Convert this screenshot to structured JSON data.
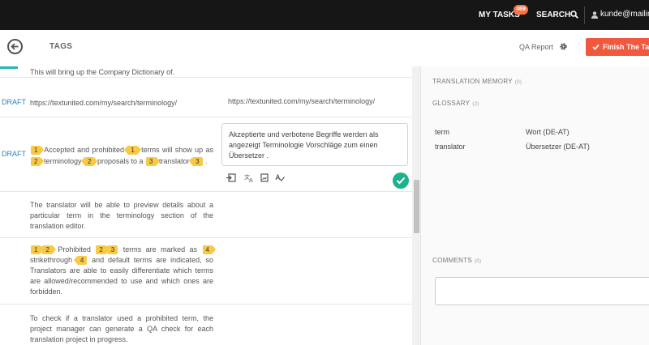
{
  "topnav": {
    "my_tasks": "MY TASKS",
    "task_count": "469",
    "search": "SEARCH",
    "user_email": "kunde@mailin"
  },
  "header": {
    "title": "TAGS",
    "qa_report": "QA Report",
    "finish": "Finish The Task"
  },
  "segments": [
    {
      "status": "",
      "source": "This will bring up the Company Dictionary of.",
      "target": ""
    },
    {
      "status": "DRAFT",
      "source": "https://textunited.com/my/search/terminology/",
      "target": "https://textunited.com/my/search/terminology/"
    },
    {
      "status": "DRAFT",
      "source_parts": [
        "Accepted and prohibited",
        "terms will show up as",
        "terminology",
        "proposals to a",
        "translator",
        "."
      ],
      "tags": [
        "1",
        "1",
        "2",
        "2",
        "3",
        "3"
      ],
      "target": "Akzeptierte und verbotene Begriffe werden als angezeigt Terminologie  Vorschläge zum einen Übersetzer  ."
    },
    {
      "status": "",
      "source": "The translator will be able to preview details about a particular term in the terminology section of the translation editor.",
      "target": ""
    },
    {
      "status": "",
      "source_parts": [
        "Prohibited",
        "terms are marked as",
        "strikethrough",
        "and default terms are indicated, so Translators are able to easily differentiate which terms are allowed/recommended to use and which ones are forbidden."
      ],
      "tags": [
        "1",
        "2",
        "2",
        "3",
        "4",
        "4"
      ],
      "target": ""
    },
    {
      "status": "",
      "source": "To check if a translator used a prohibited term, the project manager can generate a QA check for each translation project in progress.",
      "target": ""
    }
  ],
  "right_panel": {
    "translation_memory": "TRANSLATION MEMORY",
    "tm_count": "(0)",
    "glossary": "GLOSSARY",
    "glossary_count": "(2)",
    "glossary_items": [
      {
        "term": "term",
        "translation": "Wort (DE-AT)"
      },
      {
        "term": "translator",
        "translation": "Übersetzer (DE-AT)"
      }
    ],
    "comments": "COMMENTS",
    "comments_count": "(0)"
  },
  "colors": {
    "accent": "#f0593e",
    "tag": "#f7c944",
    "draft": "#2a82b7",
    "confirm": "#1fb18d"
  }
}
